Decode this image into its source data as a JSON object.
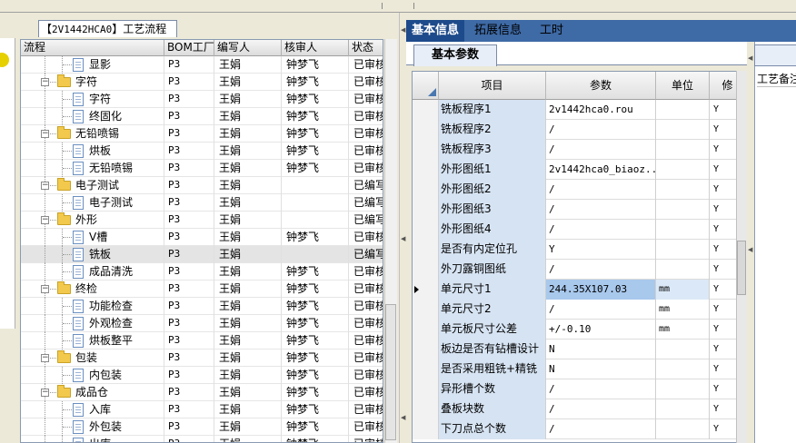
{
  "left_panel": {
    "tab_title_code": "2V1442HCA0",
    "tab_title_text": "工艺流程",
    "columns": [
      "流程",
      "BOM工厂",
      "编写人",
      "核审人",
      "状态"
    ],
    "rows": [
      {
        "name": "显影",
        "level": 2,
        "kind": "doc",
        "factory": "P3",
        "writer": "王娟",
        "reviewer": "钟梦飞",
        "status": "已审核"
      },
      {
        "name": "字符",
        "level": 1,
        "kind": "folder",
        "factory": "P3",
        "writer": "王娟",
        "reviewer": "钟梦飞",
        "status": "已审核"
      },
      {
        "name": "字符",
        "level": 2,
        "kind": "doc",
        "factory": "P3",
        "writer": "王娟",
        "reviewer": "钟梦飞",
        "status": "已审核"
      },
      {
        "name": "终固化",
        "level": 2,
        "kind": "doc",
        "factory": "P3",
        "writer": "王娟",
        "reviewer": "钟梦飞",
        "status": "已审核"
      },
      {
        "name": "无铅喷锡",
        "level": 1,
        "kind": "folder",
        "factory": "P3",
        "writer": "王娟",
        "reviewer": "钟梦飞",
        "status": "已审核"
      },
      {
        "name": "烘板",
        "level": 2,
        "kind": "doc",
        "factory": "P3",
        "writer": "王娟",
        "reviewer": "钟梦飞",
        "status": "已审核"
      },
      {
        "name": "无铅喷锡",
        "level": 2,
        "kind": "doc",
        "factory": "P3",
        "writer": "王娟",
        "reviewer": "钟梦飞",
        "status": "已审核"
      },
      {
        "name": "电子测试",
        "level": 1,
        "kind": "folder",
        "factory": "P3",
        "writer": "王娟",
        "reviewer": "",
        "status": "已编写"
      },
      {
        "name": "电子测试",
        "level": 2,
        "kind": "doc",
        "factory": "P3",
        "writer": "王娟",
        "reviewer": "",
        "status": "已编写"
      },
      {
        "name": "外形",
        "level": 1,
        "kind": "folder",
        "factory": "P3",
        "writer": "王娟",
        "reviewer": "",
        "status": "已编写"
      },
      {
        "name": "V槽",
        "level": 2,
        "kind": "doc",
        "factory": "P3",
        "writer": "王娟",
        "reviewer": "钟梦飞",
        "status": "已审核"
      },
      {
        "name": "铣板",
        "level": 2,
        "kind": "doc",
        "factory": "P3",
        "writer": "王娟",
        "reviewer": "",
        "status": "已编写",
        "selected": true
      },
      {
        "name": "成品清洗",
        "level": 2,
        "kind": "doc",
        "factory": "P3",
        "writer": "王娟",
        "reviewer": "钟梦飞",
        "status": "已审核"
      },
      {
        "name": "终检",
        "level": 1,
        "kind": "folder",
        "factory": "P3",
        "writer": "王娟",
        "reviewer": "钟梦飞",
        "status": "已审核"
      },
      {
        "name": "功能检查",
        "level": 2,
        "kind": "doc",
        "factory": "P3",
        "writer": "王娟",
        "reviewer": "钟梦飞",
        "status": "已审核"
      },
      {
        "name": "外观检查",
        "level": 2,
        "kind": "doc",
        "factory": "P3",
        "writer": "王娟",
        "reviewer": "钟梦飞",
        "status": "已审核"
      },
      {
        "name": "烘板整平",
        "level": 2,
        "kind": "doc",
        "factory": "P3",
        "writer": "王娟",
        "reviewer": "钟梦飞",
        "status": "已审核"
      },
      {
        "name": "包装",
        "level": 1,
        "kind": "folder",
        "factory": "P3",
        "writer": "王娟",
        "reviewer": "钟梦飞",
        "status": "已审核"
      },
      {
        "name": "内包装",
        "level": 2,
        "kind": "doc",
        "factory": "P3",
        "writer": "王娟",
        "reviewer": "钟梦飞",
        "status": "已审核"
      },
      {
        "name": "成品仓",
        "level": 1,
        "kind": "folder",
        "factory": "P3",
        "writer": "王娟",
        "reviewer": "钟梦飞",
        "status": "已审核"
      },
      {
        "name": "入库",
        "level": 2,
        "kind": "doc",
        "factory": "P3",
        "writer": "王娟",
        "reviewer": "钟梦飞",
        "status": "已审核"
      },
      {
        "name": "外包装",
        "level": 2,
        "kind": "doc",
        "factory": "P3",
        "writer": "王娟",
        "reviewer": "钟梦飞",
        "status": "已审核"
      },
      {
        "name": "出库",
        "level": 2,
        "kind": "doc",
        "factory": "P3",
        "writer": "王娟",
        "reviewer": "钟梦飞",
        "status": "已审核"
      }
    ]
  },
  "right_panel": {
    "tabs": [
      "基本信息",
      "拓展信息",
      "工时"
    ],
    "active_tab": 0,
    "subtab": "基本参数",
    "side_label": "工艺备注",
    "columns": [
      "项目",
      "参数",
      "单位",
      "修"
    ],
    "rows": [
      {
        "item": "铣板程序1",
        "value": "2v1442hca0.rou",
        "unit": "",
        "flag": "Y"
      },
      {
        "item": "铣板程序2",
        "value": "/",
        "unit": "",
        "flag": "Y"
      },
      {
        "item": "铣板程序3",
        "value": "/",
        "unit": "",
        "flag": "Y"
      },
      {
        "item": "外形图纸1",
        "value": "2v1442hca0_biaoz...",
        "unit": "",
        "flag": "Y"
      },
      {
        "item": "外形图纸2",
        "value": "/",
        "unit": "",
        "flag": "Y"
      },
      {
        "item": "外形图纸3",
        "value": "/",
        "unit": "",
        "flag": "Y"
      },
      {
        "item": "外形图纸4",
        "value": "/",
        "unit": "",
        "flag": "Y"
      },
      {
        "item": "是否有内定位孔",
        "value": "Y",
        "unit": "",
        "flag": "Y"
      },
      {
        "item": "外刀露铜图纸",
        "value": "/",
        "unit": "",
        "flag": "Y"
      },
      {
        "item": "单元尺寸1",
        "value": "244.35X107.03",
        "unit": "mm",
        "flag": "Y",
        "current": true
      },
      {
        "item": "单元尺寸2",
        "value": "/",
        "unit": "mm",
        "flag": "Y"
      },
      {
        "item": "单元板尺寸公差",
        "value": "+/-0.10",
        "unit": "mm",
        "flag": "Y"
      },
      {
        "item": "板边是否有钻槽设计",
        "value": "N",
        "unit": "",
        "flag": "Y"
      },
      {
        "item": "是否采用粗铣+精铣",
        "value": "N",
        "unit": "",
        "flag": "Y"
      },
      {
        "item": "异形槽个数",
        "value": "/",
        "unit": "",
        "flag": "Y"
      },
      {
        "item": "叠板块数",
        "value": "/",
        "unit": "",
        "flag": "Y"
      },
      {
        "item": "下刀点总个数",
        "value": "/",
        "unit": "",
        "flag": "Y"
      }
    ]
  },
  "colors": {
    "tab_bar": "#3e6aa6",
    "active_tab": "#1d4a8a",
    "name_cell": "#d6e3f2",
    "current_value": "#a8c8ec",
    "folder": "#f2c94c"
  }
}
